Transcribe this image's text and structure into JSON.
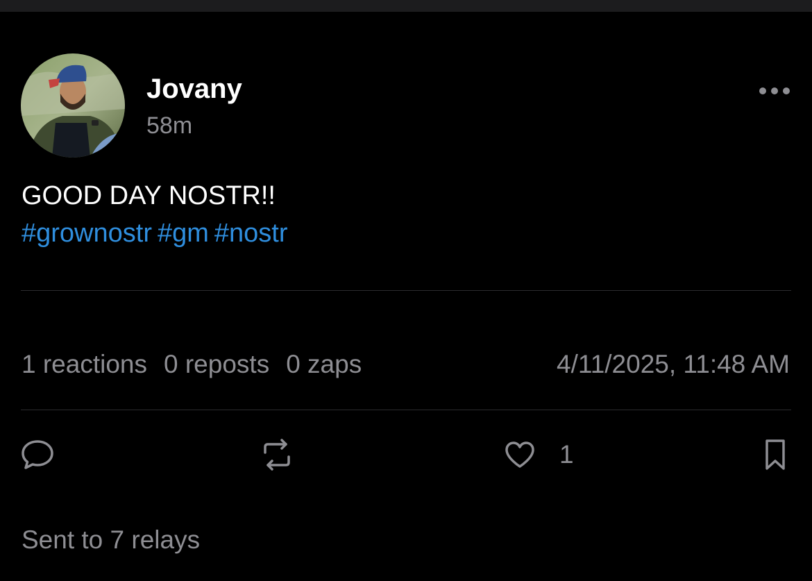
{
  "post": {
    "author": {
      "name": "Jovany",
      "avatar_icon": "user-avatar-photo"
    },
    "relative_time": "58m",
    "text": "GOOD DAY NOSTR!!",
    "hashtags": [
      "#grownostr",
      "#gm",
      "#nostr"
    ],
    "stats": {
      "reactions": "1 reactions",
      "reposts": "0 reposts",
      "zaps": "0 zaps"
    },
    "date": "4/11/2025, 11:48 AM",
    "actions": {
      "reply_icon": "chat-bubble-icon",
      "repost_icon": "repost-arrows-icon",
      "like_icon": "heart-icon",
      "like_count": "1",
      "bookmark_icon": "bookmark-icon",
      "more_icon": "ellipsis-icon"
    },
    "relays_status": "Sent to 7 relays"
  },
  "colors": {
    "background": "#000000",
    "text_primary": "#ffffff",
    "text_secondary": "#8e8e93",
    "hashtag": "#2f8ede",
    "divider": "#2c2c2e"
  }
}
